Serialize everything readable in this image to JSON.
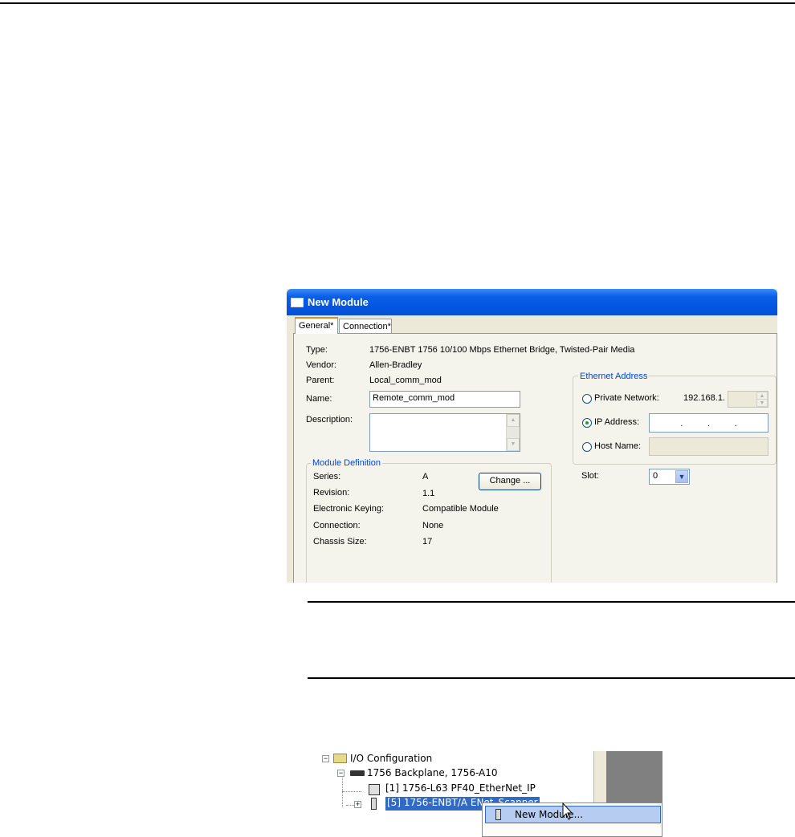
{
  "dialog": {
    "title": "New Module",
    "tabs": [
      {
        "label": "General*"
      },
      {
        "label": "Connection*"
      }
    ],
    "fields": {
      "type_label": "Type:",
      "type_value": "1756-ENBT 1756 10/100 Mbps Ethernet Bridge, Twisted-Pair Media",
      "vendor_label": "Vendor:",
      "vendor_value": "Allen-Bradley",
      "parent_label": "Parent:",
      "parent_value": "Local_comm_mod",
      "name_label": "Name:",
      "name_value": "Remote_comm_mod",
      "description_label": "Description:",
      "description_value": ""
    },
    "module_definition": {
      "legend": "Module Definition",
      "change_button": "Change ...",
      "rows": [
        {
          "label": "Series:",
          "value": "A"
        },
        {
          "label": "Revision:",
          "value": "1.1"
        },
        {
          "label": "Electronic Keying:",
          "value": "Compatible Module"
        },
        {
          "label": "Connection:",
          "value": "None"
        },
        {
          "label": "Chassis Size:",
          "value": "17"
        }
      ]
    },
    "ethernet": {
      "legend": "Ethernet Address",
      "private_network_label": "Private Network:",
      "private_network_prefix": "192.168.1.",
      "ip_address_label": "IP Address:",
      "ip_address_dots": ".          .          .",
      "host_name_label": "Host Name:",
      "selected": "IP Address"
    },
    "slot": {
      "label": "Slot:",
      "value": "0"
    }
  },
  "tree": {
    "items": [
      {
        "label": "I/O Configuration"
      },
      {
        "label": "1756 Backplane, 1756-A10"
      },
      {
        "label": "[1] 1756-L63 PF40_EtherNet_IP"
      },
      {
        "label": "[5] 1756-ENBT/A ENet_Scanner"
      }
    ],
    "context_menu": {
      "item": "New Module..."
    }
  }
}
